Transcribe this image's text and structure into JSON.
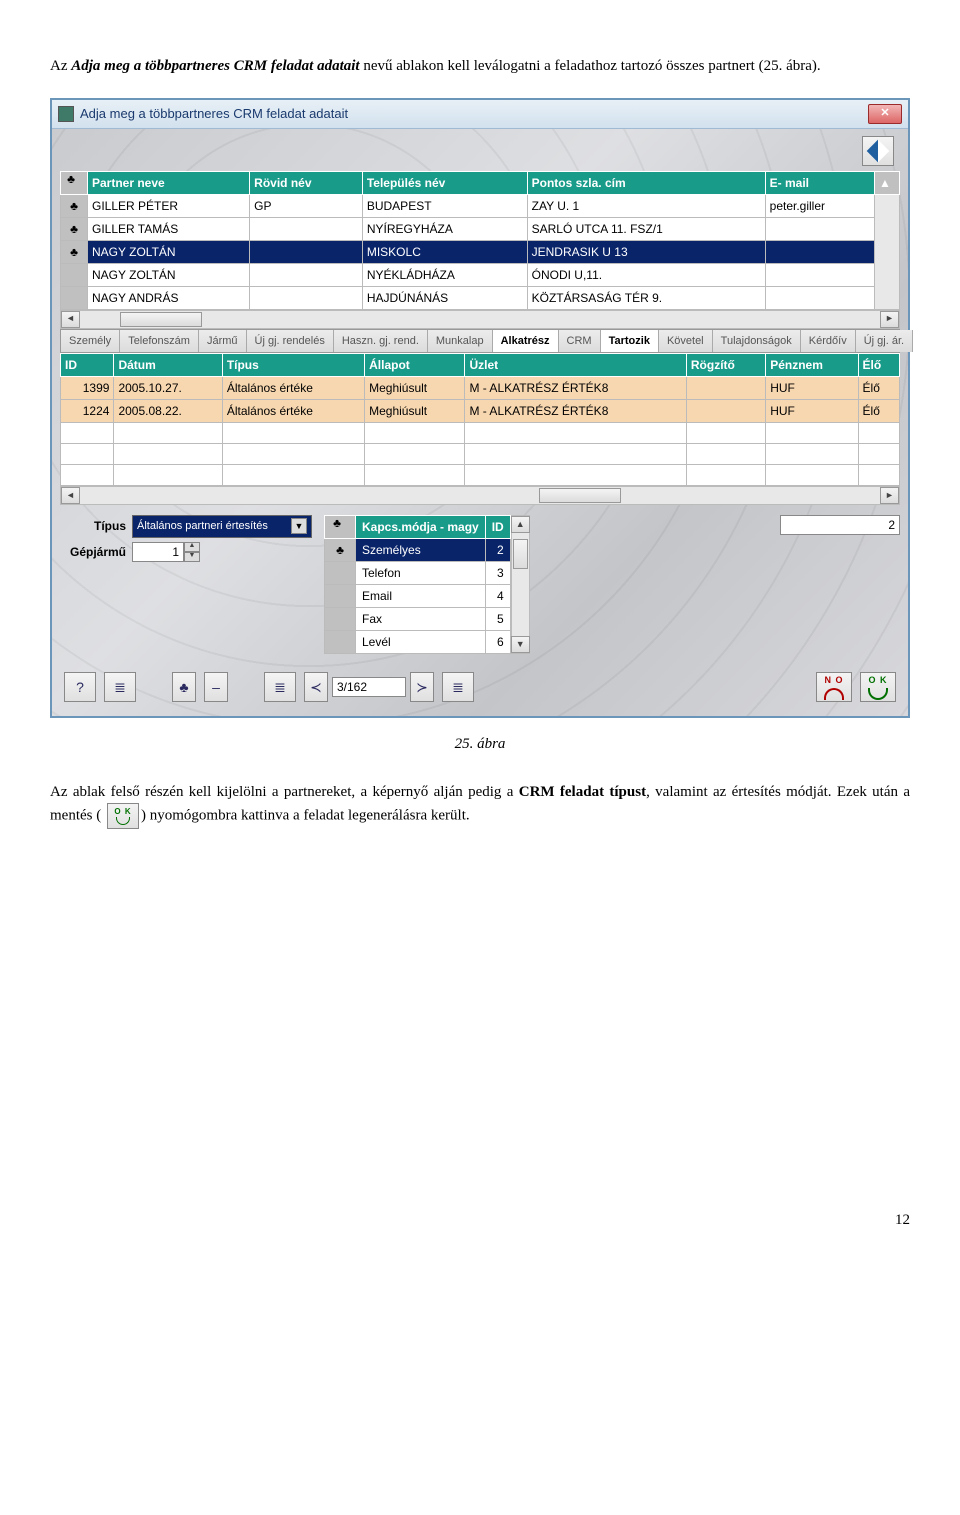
{
  "intro": {
    "pre": "Az ",
    "title_bold": "Adja meg a többpartneres CRM feladat adatait",
    "post": " nevű ablakon kell leválogatni a feladathoz tartozó összes partnert (25. ábra)."
  },
  "window": {
    "title": "Adja meg a többpartneres CRM feladat adatait",
    "close_x": "✕",
    "partner_headers": [
      "Partner neve",
      "Rövid név",
      "Település név",
      "Pontos szla. cím",
      "E- mail"
    ],
    "partner_rows": [
      {
        "mark": "♣",
        "name": "GILLER PÉTER",
        "rovid": "GP",
        "telep": "BUDAPEST",
        "cim": "ZAY U. 1",
        "email": "peter.giller",
        "selected": false
      },
      {
        "mark": "♣",
        "name": "GILLER TAMÁS",
        "rovid": "",
        "telep": "NYÍREGYHÁZA",
        "cim": "SARLÓ UTCA 11. FSZ/1",
        "email": "",
        "selected": false
      },
      {
        "mark": "♣",
        "name": "NAGY   ZOLTÁN",
        "rovid": "",
        "telep": "MISKOLC",
        "cim": "JENDRASIK U 13",
        "email": "",
        "selected": true
      },
      {
        "mark": "",
        "name": "NAGY  ZOLTÁN",
        "rovid": "",
        "telep": "NYÉKLÁDHÁZA",
        "cim": "ÓNODI U,11.",
        "email": "",
        "selected": false
      },
      {
        "mark": "",
        "name": "NAGY ANDRÁS",
        "rovid": "",
        "telep": "HAJDÚNÁNÁS",
        "cim": "KÖZTÁRSASÁG TÉR 9.",
        "email": "",
        "selected": false
      }
    ],
    "tabs": [
      "Személy",
      "Telefonszám",
      "Jármű",
      "Új gj. rendelés",
      "Haszn. gj. rend.",
      "Munkalap",
      "Alkatrész",
      "CRM",
      "Tartozik",
      "Követel",
      "Tulajdonságok",
      "Kérdőív",
      "Új gj. ár."
    ],
    "tabs_active": [
      6,
      8
    ],
    "detail_headers": [
      "ID",
      "Dátum",
      "Típus",
      "Állapot",
      "Üzlet",
      "Rögzítő",
      "Pénznem",
      "Élő"
    ],
    "detail_rows": [
      {
        "id": "1399",
        "datum": "2005.10.27.",
        "tipus": "Általános értéke",
        "allapot": "Meghiúsult",
        "uzlet": "M - ALKATRÉSZ ÉRTÉK8",
        "rogzito": "",
        "penznem": "HUF",
        "elo": "Élő"
      },
      {
        "id": "1224",
        "datum": "2005.08.22.",
        "tipus": "Általános értéke",
        "allapot": "Meghiúsult",
        "uzlet": "M - ALKATRÉSZ ÉRTÉK8",
        "rogzito": "",
        "penznem": "HUF",
        "elo": "Élő"
      }
    ],
    "form": {
      "tipus_label": "Típus",
      "tipus_value": "Általános partneri értesítés",
      "gepjarmu_label": "Gépjármű",
      "gepjarmu_value": "1"
    },
    "kapcs_headers": [
      "Kapcs.módja - magy",
      "ID"
    ],
    "kapcs_rows": [
      {
        "name": "Személyes",
        "id": "2",
        "selected": true
      },
      {
        "name": "Telefon",
        "id": "3",
        "selected": false
      },
      {
        "name": "Email",
        "id": "4",
        "selected": false
      },
      {
        "name": "Fax",
        "id": "5",
        "selected": false
      },
      {
        "name": "Levél",
        "id": "6",
        "selected": false
      }
    ],
    "right_input": "2",
    "pager": "3/162",
    "no_label": "N O",
    "ok_label": "O K"
  },
  "caption": "25. ábra",
  "para2": {
    "p1": "Az ablak felső részén kell kijelölni a partnereket, a képernyő alján pedig a ",
    "bold1": "CRM feladat típust",
    "p2": ", valamint az értesítés módját. Ezek után a ",
    "mentes": "mentés",
    "p3": " ( ",
    "p4": ") nyomógombra kattinva a feladat legenerálásra került."
  },
  "page_number": "12"
}
